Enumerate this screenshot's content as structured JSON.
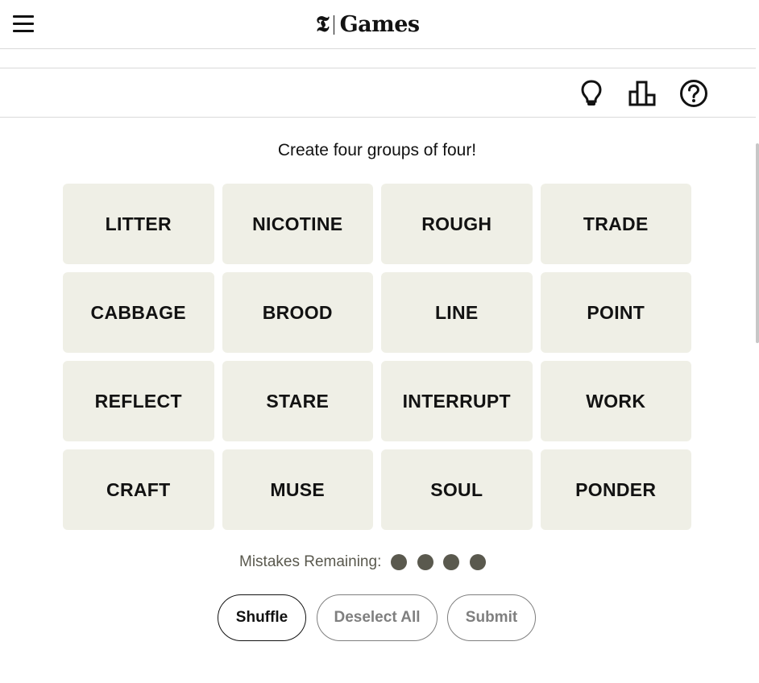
{
  "header": {
    "logo_mark": "𝕿",
    "brand_name": "Games"
  },
  "toolbar": {
    "icons": [
      "lightbulb-icon",
      "leaderboard-icon",
      "help-icon"
    ]
  },
  "game": {
    "subtitle": "Create four groups of four!",
    "tiles": [
      "LITTER",
      "NICOTINE",
      "ROUGH",
      "TRADE",
      "CABBAGE",
      "BROOD",
      "LINE",
      "POINT",
      "REFLECT",
      "STARE",
      "INTERRUPT",
      "WORK",
      "CRAFT",
      "MUSE",
      "SOUL",
      "PONDER"
    ],
    "mistakes_label": "Mistakes Remaining:",
    "mistakes_remaining": 4
  },
  "actions": {
    "shuffle_label": "Shuffle",
    "deselect_label": "Deselect All",
    "submit_label": "Submit"
  },
  "colors": {
    "tile_bg": "#efefe6",
    "mistake_dot": "#5a594e",
    "text": "#121212",
    "disabled": "#7f7f7f"
  }
}
